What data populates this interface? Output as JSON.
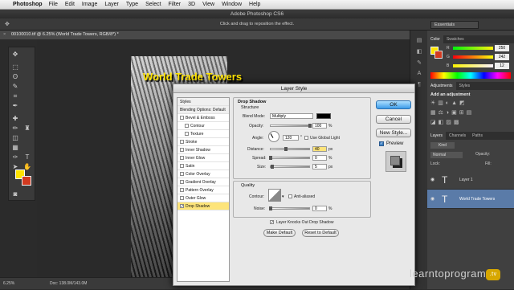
{
  "menubar": {
    "app": "Photoshop",
    "items": [
      "File",
      "Edit",
      "Image",
      "Layer",
      "Type",
      "Select",
      "Filter",
      "3D",
      "View",
      "Window",
      "Help"
    ]
  },
  "window_title": "Adobe Photoshop CS6",
  "options_hint": "Click and drag to reposition the effect.",
  "workspace": "Essentials",
  "document_tab": "00100010.tif @ 6.25% (World Trade Towers, RGB/8*) *",
  "canvas_text": "World Trade Towers",
  "status": {
    "zoom": "6.25%",
    "doc": "Doc: 138.0M/143.0M"
  },
  "color_panel": {
    "tabs": [
      "Color",
      "Swatches"
    ],
    "r": {
      "label": "R",
      "value": "250"
    },
    "g": {
      "label": "G",
      "value": "242"
    },
    "b": {
      "label": "B",
      "value": "12"
    }
  },
  "adjust_panel": {
    "tabs": [
      "Adjustments",
      "Styles"
    ],
    "title": "Add an adjustment"
  },
  "layers_panel": {
    "tabs": [
      "Layers",
      "Channels",
      "Paths"
    ],
    "kind": "Kind",
    "blend": "Normal",
    "opacity_label": "Opacity:",
    "fill_label": "Fill:",
    "lock_label": "Lock:",
    "layers": [
      "Layer 1",
      "World Trade Towers"
    ]
  },
  "dialog": {
    "title": "Layer Style",
    "styles_header": "Styles",
    "blending": "Blending Options: Default",
    "items": [
      {
        "label": "Bevel & Emboss",
        "checked": false,
        "indent": false
      },
      {
        "label": "Contour",
        "checked": false,
        "indent": true
      },
      {
        "label": "Texture",
        "checked": false,
        "indent": true
      },
      {
        "label": "Stroke",
        "checked": false,
        "indent": false
      },
      {
        "label": "Inner Shadow",
        "checked": false,
        "indent": false
      },
      {
        "label": "Inner Glow",
        "checked": false,
        "indent": false
      },
      {
        "label": "Satin",
        "checked": false,
        "indent": false
      },
      {
        "label": "Color Overlay",
        "checked": false,
        "indent": false
      },
      {
        "label": "Gradient Overlay",
        "checked": false,
        "indent": false
      },
      {
        "label": "Pattern Overlay",
        "checked": false,
        "indent": false
      },
      {
        "label": "Outer Glow",
        "checked": false,
        "indent": false
      },
      {
        "label": "Drop Shadow",
        "checked": true,
        "indent": false
      }
    ],
    "section_title": "Drop Shadow",
    "structure": "Structure",
    "blend_mode_label": "Blend Mode:",
    "blend_mode": "Multiply",
    "opacity_label": "Opacity:",
    "opacity": "100",
    "angle_label": "Angle:",
    "angle": "120",
    "global_light": "Use Global Light",
    "distance_label": "Distance:",
    "distance": "40",
    "spread_label": "Spread:",
    "spread": "0",
    "size_label": "Size:",
    "size": "5",
    "quality": "Quality",
    "contour_label": "Contour:",
    "anti_aliased": "Anti-aliased",
    "noise_label": "Noise:",
    "noise": "0",
    "knockout": "Layer Knocks Out Drop Shadow",
    "make_default": "Make Default",
    "reset_default": "Reset to Default",
    "unit_pct": "%",
    "unit_px": "px",
    "unit_deg": "°",
    "ok": "OK",
    "cancel": "Cancel",
    "new_style": "New Style...",
    "preview": "Preview"
  },
  "watermark": {
    "text": "learntoprogram",
    "badge": ".tv"
  }
}
